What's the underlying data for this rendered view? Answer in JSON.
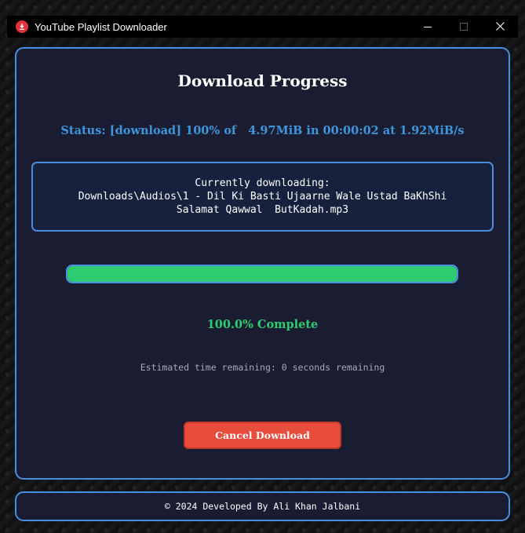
{
  "window": {
    "title": "YouTube Playlist Downloader"
  },
  "main": {
    "heading": "Download Progress",
    "status": "Status: [download] 100% of   4.97MiB in 00:00:02 at 1.92MiB/s",
    "current_label": "Currently downloading:",
    "current_file_line1": "Downloads\\Audios\\1 - Dil Ki Basti Ujaarne Wale Ustad BaKhShi",
    "current_file_line2": "Salamat Qawwal  ButKadah.mp3",
    "progress_percent": 100,
    "complete_text": "100.0% Complete",
    "eta_text": "Estimated time remaining: 0 seconds remaining",
    "cancel_label": "Cancel Download"
  },
  "footer": {
    "text": "© 2024 Developed By Ali Khan Jalbani"
  },
  "colors": {
    "accent_blue": "#4a8ee0",
    "status_blue": "#3d96db",
    "success_green": "#2ecc71",
    "danger_red": "#e74c3c",
    "panel_bg": "#1a1d31"
  },
  "icons": {
    "app": "download-icon",
    "minimize": "minimize-icon",
    "maximize": "maximize-icon",
    "close": "close-icon"
  }
}
